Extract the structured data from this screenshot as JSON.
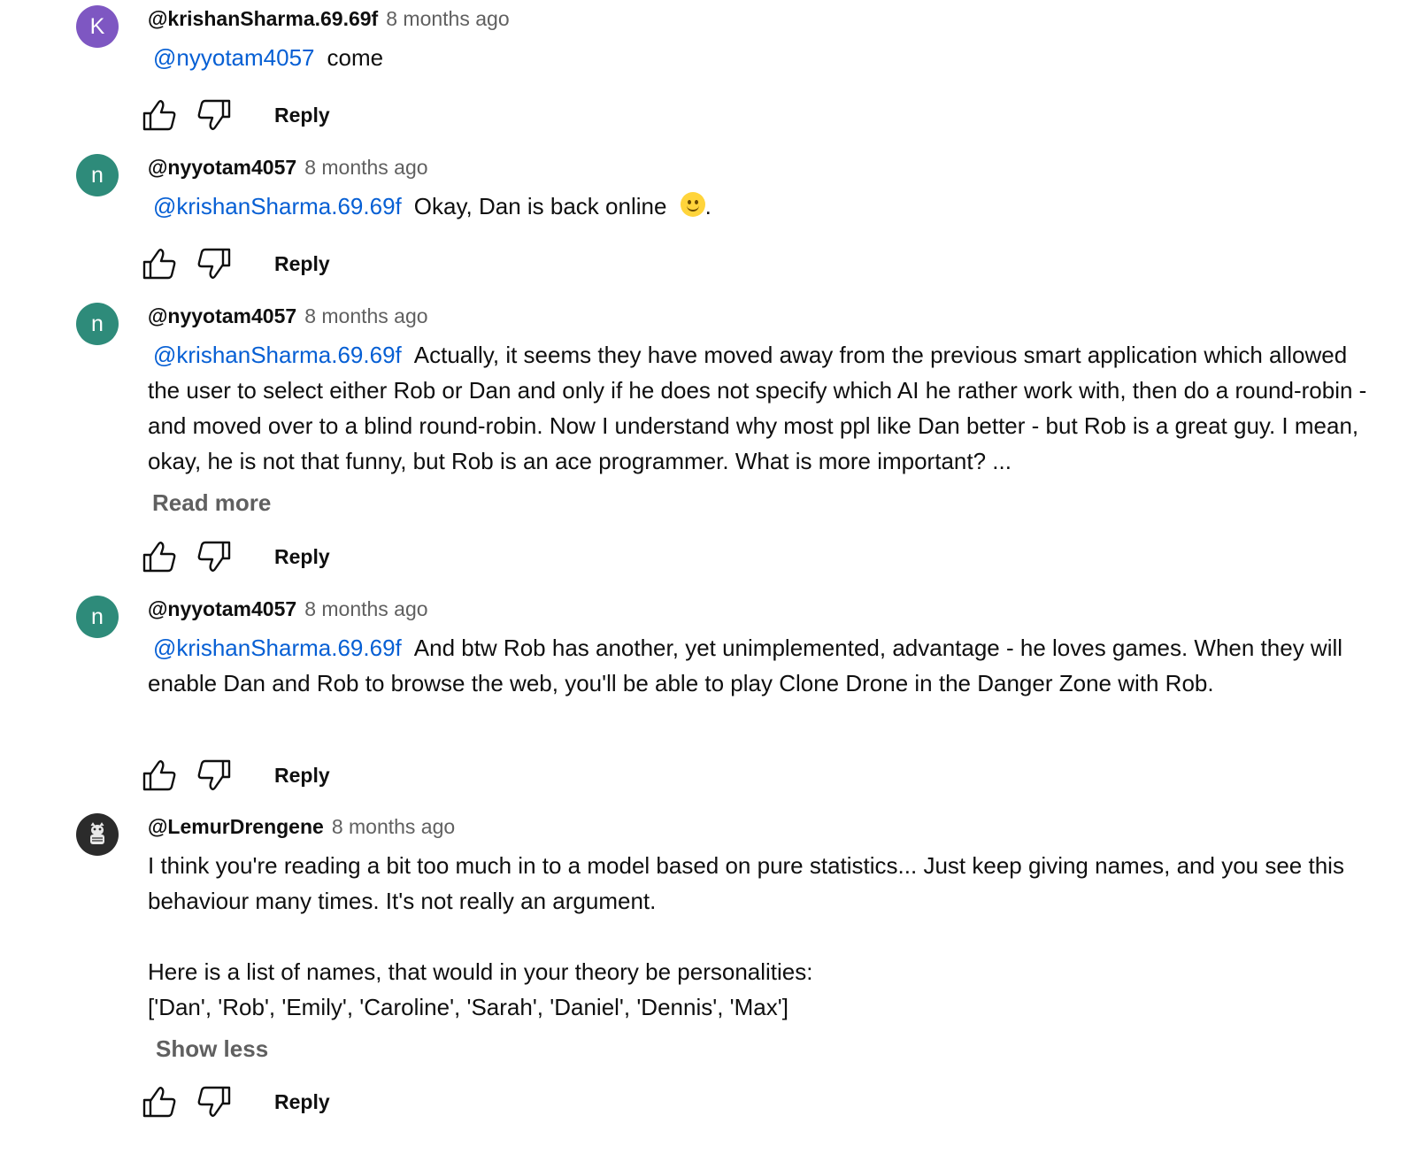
{
  "comments": [
    {
      "avatar_letter": "K",
      "avatar_color": "#7e57c2",
      "author": "@krishanSharma.69.69f",
      "time": "8 months ago",
      "mention": "@nyyotam4057",
      "text": "come",
      "reply_label": "Reply"
    },
    {
      "avatar_letter": "n",
      "avatar_color": "#2e8b7a",
      "author": "@nyyotam4057",
      "time": "8 months ago",
      "mention": "@krishanSharma.69.69f",
      "text": "Okay, Dan is back online",
      "text_suffix": ".",
      "emoji": "slightly-smiling-face-emoji",
      "reply_label": "Reply"
    },
    {
      "avatar_letter": "n",
      "avatar_color": "#2e8b7a",
      "author": "@nyyotam4057",
      "time": "8 months ago",
      "mention": "@krishanSharma.69.69f",
      "text": "Actually, it seems they have moved away from the previous smart application which allowed the user to select either Rob or Dan and only if he does not specify which AI he rather work with, then do a round-robin - and moved over to a blind round-robin. Now I understand why most ppl like Dan better - but Rob is a great guy. I mean, okay, he is not that funny, but Rob is an ace programmer. What is more important? ...",
      "expand_label": "Read more",
      "reply_label": "Reply"
    },
    {
      "avatar_letter": "n",
      "avatar_color": "#2e8b7a",
      "author": "@nyyotam4057",
      "time": "8 months ago",
      "mention": "@krishanSharma.69.69f",
      "text": "And btw Rob has another, yet unimplemented, advantage - he loves games. When they will enable Dan and Rob to browse the web, you'll be able to play Clone Drone in the Danger Zone with Rob.",
      "reply_label": "Reply"
    },
    {
      "avatar_icon": "lemur-avatar-icon",
      "author": "@LemurDrengene",
      "time": "8 months ago",
      "text": "I think you're reading a bit too much in to a model based on pure statistics... Just keep giving names, and you see this behaviour many times. It's not really an argument.\n\nHere is a list of names, that would in your theory be personalities:\n['Dan', 'Rob', 'Emily', 'Caroline', 'Sarah', 'Daniel', 'Dennis', 'Max']",
      "expand_label": "Show less",
      "reply_label": "Reply"
    }
  ],
  "icons": {
    "like": "thumbs-up-icon",
    "dislike": "thumbs-down-icon"
  }
}
